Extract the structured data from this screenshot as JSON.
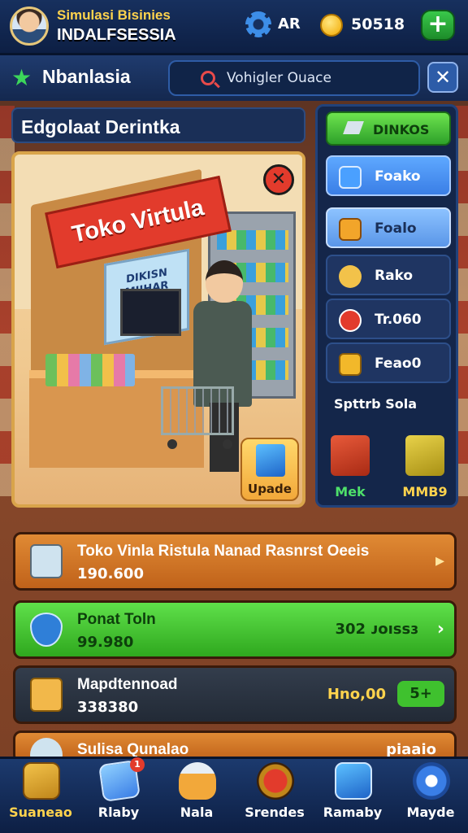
{
  "header": {
    "title_line1": "Simulasi Bisinies",
    "title_line2": "INDALFSESSIA",
    "level": "AR",
    "coins": "50518",
    "add_label": "+"
  },
  "subbar": {
    "location": "Nbanlasia",
    "search_text": "Vohigler Ouace",
    "close_label": "✕"
  },
  "main": {
    "panel_title": "Edgolaat Derintka",
    "scene_sign": "Toko Virtula",
    "scene_poster": "DIKISN MIJHAR HUPIOA",
    "close_scene_label": "✕",
    "upgrade_label": "Upade"
  },
  "side": {
    "top_label": "DINKOS",
    "items": [
      {
        "label": "Foako"
      },
      {
        "label": "Foalo"
      },
      {
        "label": "Rako"
      },
      {
        "label": "Tr.060"
      },
      {
        "label": "Feao0"
      }
    ],
    "last_label": "Spttrb Sola",
    "boxes": [
      {
        "label": "Mek"
      },
      {
        "label": "MMB9"
      }
    ]
  },
  "rows": [
    {
      "title": "Toko Vinla Ristula Nanad Rasnrst Oeeis",
      "sub": "190.600",
      "right": "▸"
    },
    {
      "title": "Ponat Toln",
      "sub": "99.980",
      "right": "302 ᴊoıssɜ"
    },
    {
      "title": "Mapdtennoad",
      "sub": "338380",
      "right": "Hno,00",
      "right_badge": "5+"
    },
    {
      "title": "Sulisa Qunalao",
      "sub": "",
      "right": "piaaio"
    }
  ],
  "nav": [
    {
      "label": "Suaneao"
    },
    {
      "label": "Rlaby",
      "badge": "1"
    },
    {
      "label": "Nala"
    },
    {
      "label": "Srendes"
    },
    {
      "label": "Ramaby"
    },
    {
      "label": "Mayde"
    }
  ],
  "colors": {
    "accent_green": "#39c84a",
    "accent_blue": "#3a7ee6",
    "row_orange": "#d9782a",
    "row_green": "#3fc12e",
    "row_dark": "#2b3340"
  }
}
